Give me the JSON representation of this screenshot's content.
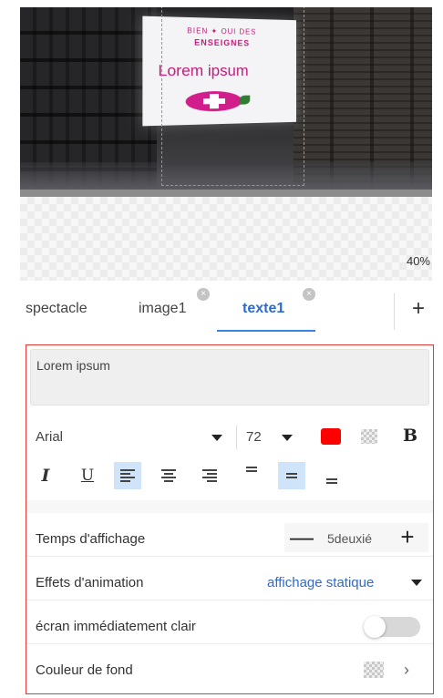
{
  "preview": {
    "sign_top_line": "BIEN ✦ OUI DES",
    "sign_brand": "ENSEIGNES",
    "sign_text": "Lorem ipsum",
    "zoom": "40%"
  },
  "tabs": {
    "items": [
      {
        "label": "spectacle",
        "closable": false,
        "active": false
      },
      {
        "label": "image1",
        "closable": true,
        "active": false
      },
      {
        "label": "texte1",
        "closable": true,
        "active": true
      }
    ],
    "add_label": "+",
    "close_glyph": "×"
  },
  "editor": {
    "text_value": "Lorem ipsum",
    "font_family": "Arial",
    "font_size": "72",
    "text_color": "#ff0000",
    "bold_label": "B",
    "italic_label": "I",
    "underline_label": "U"
  },
  "settings": {
    "display_time_label": "Temps d'affichage",
    "display_time_value": "5deuxié",
    "minus_label": "—",
    "plus_label": "+",
    "animation_label": "Effets d'animation",
    "animation_value": "affichage statique",
    "clear_screen_label": "écran immédiatement clair",
    "clear_screen_on": false,
    "bg_color_label": "Couleur de fond",
    "chevron": "›"
  },
  "colors": {
    "accent": "#2e6bd1",
    "panel_border": "#e53935",
    "selected_bg": "#cfe3f9"
  }
}
